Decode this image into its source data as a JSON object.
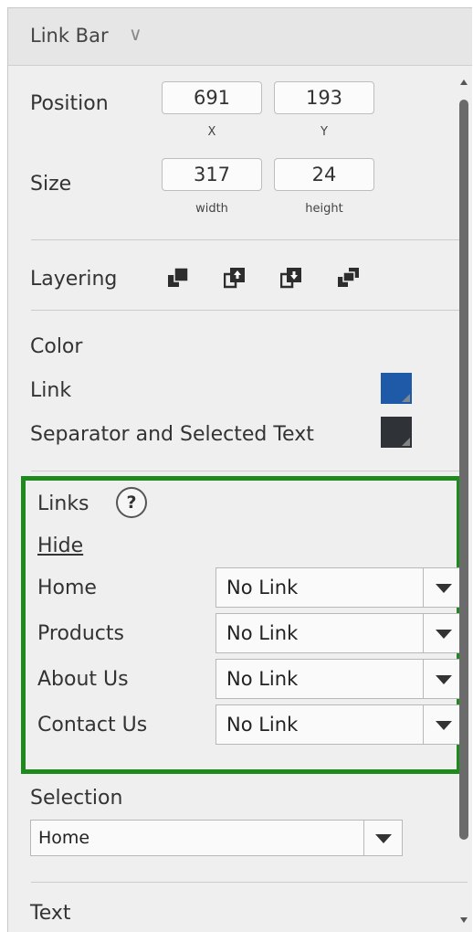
{
  "header": {
    "title": "Link Bar",
    "chevron_icon": "chevron-down-icon"
  },
  "position": {
    "label": "Position",
    "x_value": "691",
    "y_value": "193",
    "x_caption": "X",
    "y_caption": "Y"
  },
  "size": {
    "label": "Size",
    "width_value": "317",
    "height_value": "24",
    "width_caption": "width",
    "height_caption": "height"
  },
  "layering": {
    "label": "Layering",
    "icons": [
      "bring-to-front-icon",
      "bring-forward-icon",
      "send-backward-icon",
      "send-to-back-icon"
    ]
  },
  "color": {
    "heading": "Color",
    "link_label": "Link",
    "link_color": "#1e5aa8",
    "separator_label": "Separator and Selected Text",
    "separator_color": "#2f3236"
  },
  "links": {
    "heading": "Links",
    "help_symbol": "?",
    "hide_label": "Hide",
    "items": [
      {
        "label": "Home",
        "value": "No Link"
      },
      {
        "label": "Products",
        "value": "No Link"
      },
      {
        "label": "About Us",
        "value": "No Link"
      },
      {
        "label": "Contact Us",
        "value": "No Link"
      }
    ],
    "highlight_color": "#1d8a1d"
  },
  "selection": {
    "label": "Selection",
    "value": "Home"
  },
  "text_section": {
    "label": "Text"
  }
}
